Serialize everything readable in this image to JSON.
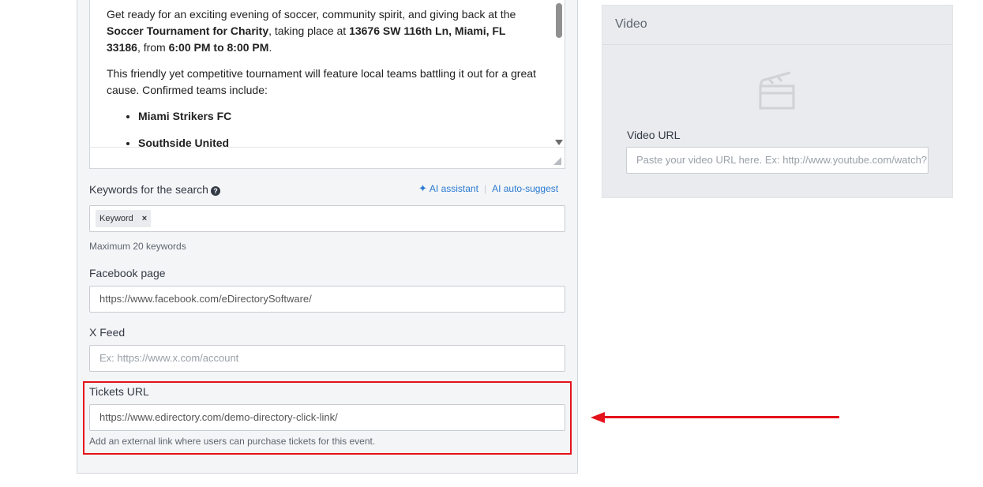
{
  "editor": {
    "p1_a": "Get ready for an exciting evening of soccer, community spirit, and giving back at the ",
    "p1_b": "Soccer Tournament for Charity",
    "p1_c": ", taking place at ",
    "p1_d": "13676 SW 116th Ln, Miami, FL 33186",
    "p1_e": ", from ",
    "p1_f": "6:00 PM to 8:00 PM",
    "p1_g": ".",
    "p2": "This friendly yet competitive tournament will feature local teams battling it out for a great cause. Confirmed teams include:",
    "teams": [
      "Miami Strikers FC",
      "Southside United"
    ]
  },
  "keywords": {
    "label": "Keywords for the search",
    "help_icon": "question-circle-icon",
    "ai_assistant": "AI assistant",
    "ai_autosuggest": "AI auto-suggest",
    "tag": "Keyword",
    "tag_remove": "×",
    "help": "Maximum 20 keywords"
  },
  "facebook": {
    "label": "Facebook page",
    "value": "https://www.facebook.com/eDirectorySoftware/"
  },
  "xfeed": {
    "label": "X Feed",
    "placeholder": "Ex: https://www.x.com/account"
  },
  "tickets": {
    "label": "Tickets URL",
    "value": "https://www.edirectory.com/demo-directory-click-link/",
    "help": "Add an external link where users can purchase tickets for this event."
  },
  "video": {
    "title": "Video",
    "icon": "clapperboard-icon",
    "url_label": "Video URL",
    "url_placeholder": "Paste your video URL here. Ex: http://www.youtube.com/watch?"
  },
  "colors": {
    "highlight": "#e4121b",
    "link": "#2a7ad1"
  }
}
